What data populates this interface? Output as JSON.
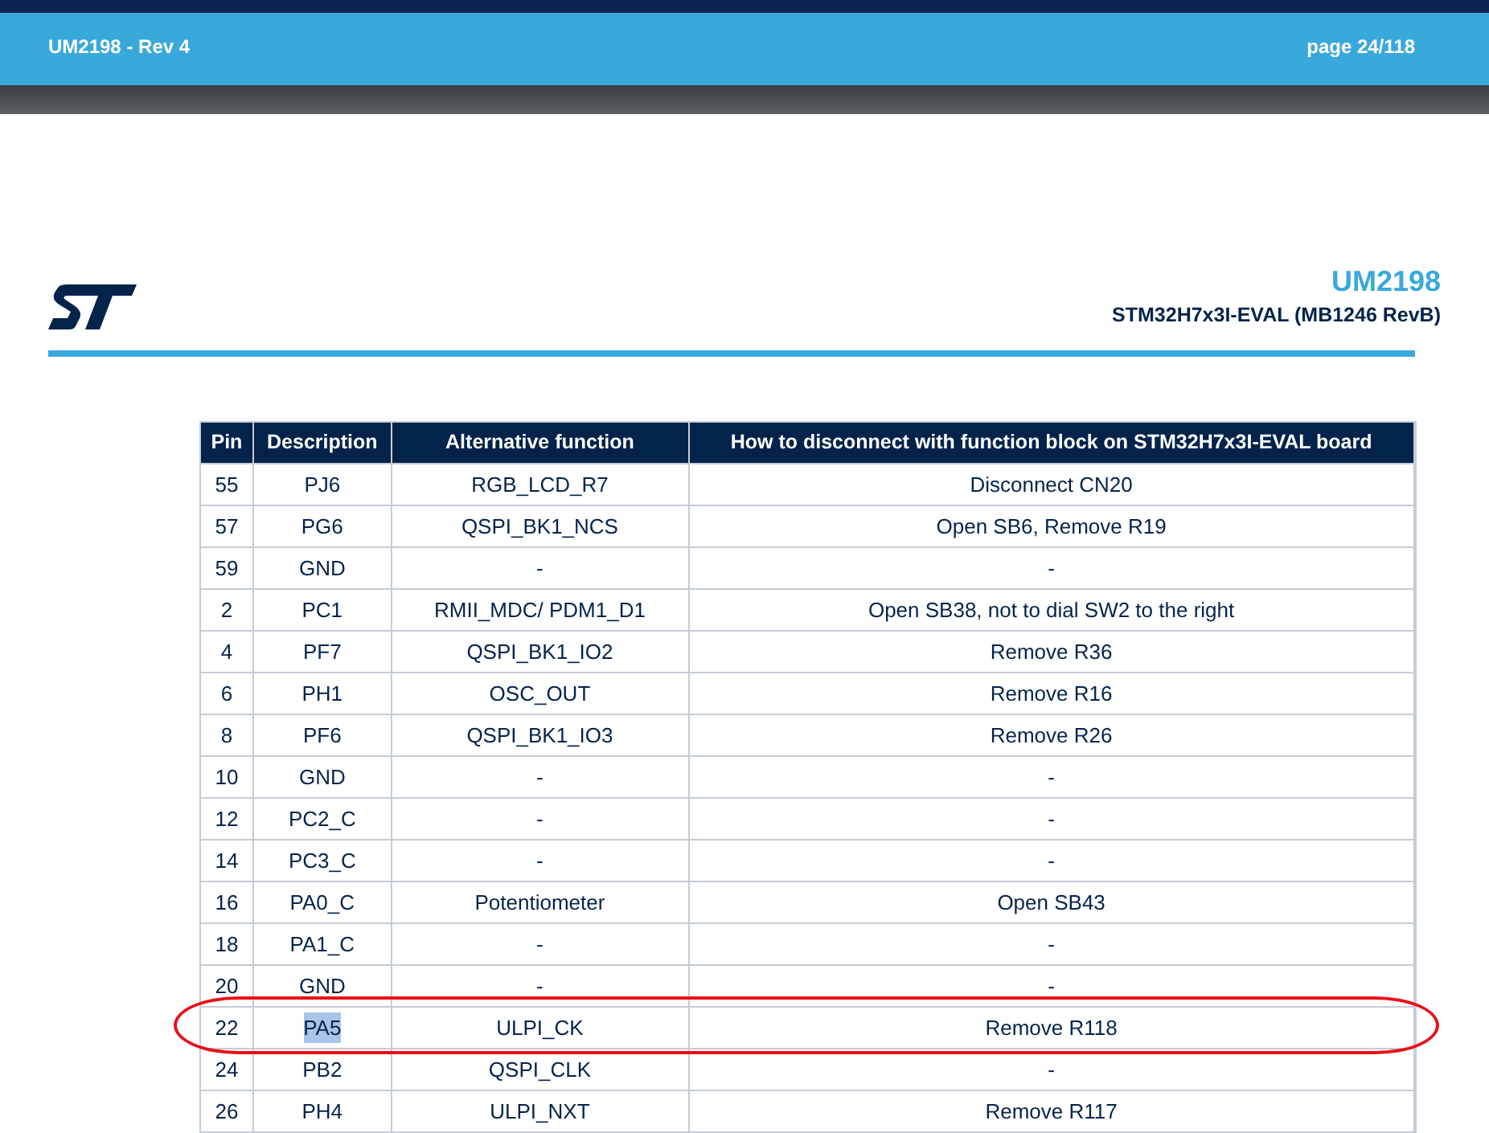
{
  "viewer_header": {
    "document": "UM2198 - Rev 4",
    "page": "page 24/118"
  },
  "page_header": {
    "doc_id": "UM2198",
    "board": "STM32H7x3I-EVAL (MB1246 RevB)"
  },
  "table": {
    "columns": [
      "Pin",
      "Description",
      "Alternative function",
      "How to disconnect with function block on STM32H7x3I-EVAL board"
    ],
    "rows": [
      {
        "cells": [
          "55",
          "PJ6",
          "RGB_LCD_R7",
          "Disconnect CN20"
        ],
        "circled": false,
        "text_selected": false
      },
      {
        "cells": [
          "57",
          "PG6",
          "QSPI_BK1_NCS",
          "Open SB6, Remove R19"
        ],
        "circled": false,
        "text_selected": false
      },
      {
        "cells": [
          "59",
          "GND",
          "-",
          "-"
        ],
        "circled": false,
        "text_selected": false
      },
      {
        "cells": [
          "2",
          "PC1",
          "RMII_MDC/ PDM1_D1",
          "Open SB38, not to dial SW2 to the right"
        ],
        "circled": false,
        "text_selected": false
      },
      {
        "cells": [
          "4",
          "PF7",
          "QSPI_BK1_IO2",
          "Remove R36"
        ],
        "circled": false,
        "text_selected": false
      },
      {
        "cells": [
          "6",
          "PH1",
          "OSC_OUT",
          "Remove R16"
        ],
        "circled": false,
        "text_selected": false
      },
      {
        "cells": [
          "8",
          "PF6",
          "QSPI_BK1_IO3",
          "Remove R26"
        ],
        "circled": false,
        "text_selected": false
      },
      {
        "cells": [
          "10",
          "GND",
          "-",
          "-"
        ],
        "circled": false,
        "text_selected": false
      },
      {
        "cells": [
          "12",
          "PC2_C",
          "-",
          "-"
        ],
        "circled": false,
        "text_selected": false
      },
      {
        "cells": [
          "14",
          "PC3_C",
          "-",
          "-"
        ],
        "circled": false,
        "text_selected": false
      },
      {
        "cells": [
          "16",
          "PA0_C",
          "Potentiometer",
          "Open SB43"
        ],
        "circled": false,
        "text_selected": false
      },
      {
        "cells": [
          "18",
          "PA1_C",
          "-",
          "-"
        ],
        "circled": false,
        "text_selected": false
      },
      {
        "cells": [
          "20",
          "GND",
          "-",
          "-"
        ],
        "circled": false,
        "text_selected": false
      },
      {
        "cells": [
          "22",
          "PA5",
          "ULPI_CK",
          "Remove R118"
        ],
        "circled": true,
        "text_selected": true
      },
      {
        "cells": [
          "24",
          "PB2",
          "QSPI_CLK",
          "-"
        ],
        "circled": false,
        "text_selected": false
      },
      {
        "cells": [
          "26",
          "PH4",
          "ULPI_NXT",
          "Remove R117"
        ],
        "circled": false,
        "text_selected": false
      }
    ]
  }
}
